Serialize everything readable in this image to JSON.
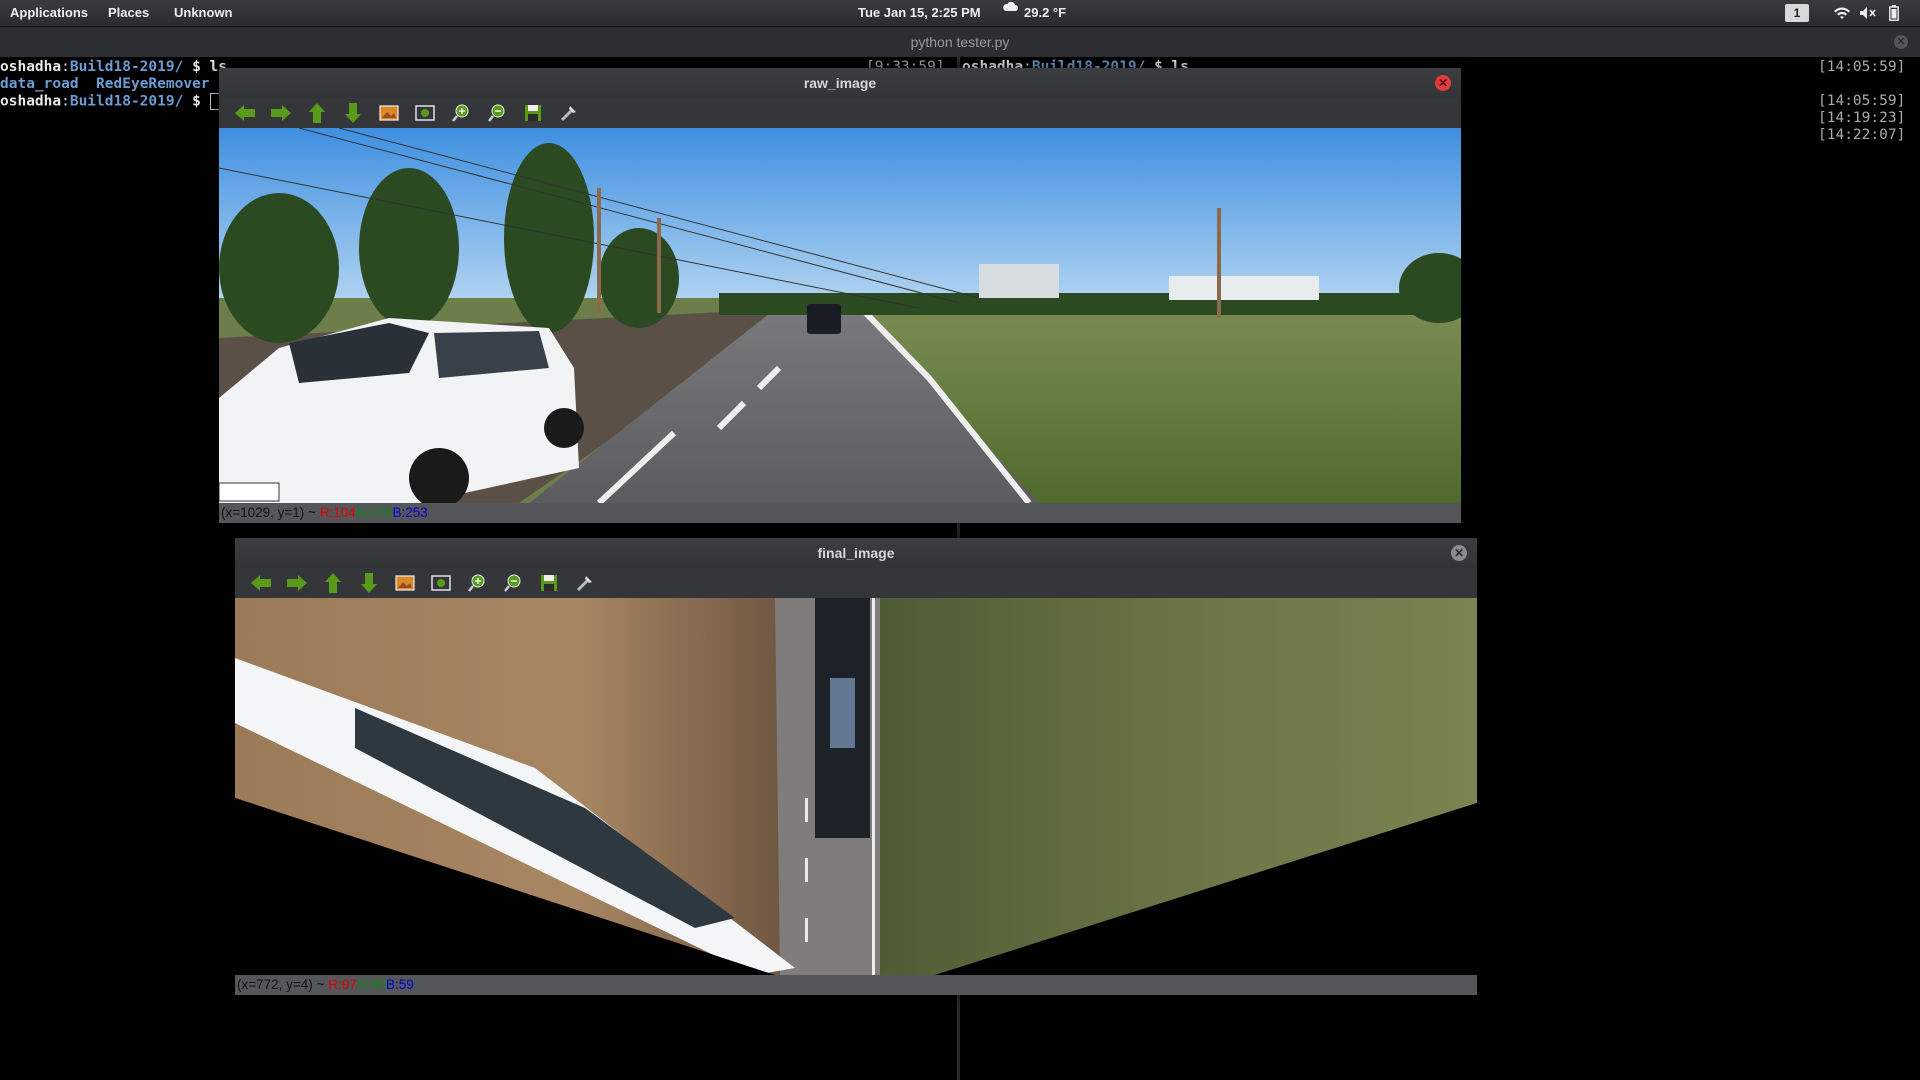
{
  "panel": {
    "applications": "Applications",
    "places": "Places",
    "app_menu": "Unknown",
    "clock": "Tue Jan 15,  2:25 PM",
    "weather": "29.2 °F",
    "workspace": "1"
  },
  "terminal": {
    "title": "python tester.py",
    "left_pane": {
      "line1": {
        "user": "oshadha",
        "path": "Build18-2019/",
        "prompt": " $ ls",
        "stamp": "[9:33:59]"
      },
      "line2": {
        "dir1": "data_road",
        "dir2": "RedEyeRemover"
      },
      "line3": {
        "user": "oshadha",
        "path": "Build18-2019/",
        "prompt": " $ "
      }
    },
    "right_pane": {
      "line1": {
        "user": "oshadha",
        "path": "Build18-2019/",
        "prompt": " $ ls",
        "stamp": "[14:05:59]"
      },
      "stamps": [
        "[14:05:59]",
        "[14:19:23]",
        "[14:22:07]"
      ]
    }
  },
  "raw_window": {
    "title": "raw_image",
    "status": {
      "coords": "(x=1029, y=1) ~ ",
      "r": "R:104",
      "g": "G:176",
      "b": "B:253"
    }
  },
  "final_window": {
    "title": "final_image",
    "status": {
      "coords": "(x=772, y=4) ~ ",
      "r": "R:97",
      "g": "G:80",
      "b": "B:59"
    }
  },
  "toolbar_icons": [
    "arrow-left-icon",
    "arrow-right-icon",
    "arrow-up-icon",
    "arrow-down-icon",
    "image-icon",
    "fit-window-icon",
    "zoom-in-icon",
    "zoom-out-icon",
    "save-icon",
    "properties-icon"
  ],
  "colors": {
    "close_red": "#e03c3c",
    "icon_green": "#5a9a1a",
    "terminal_blue": "#6c9bd2"
  }
}
